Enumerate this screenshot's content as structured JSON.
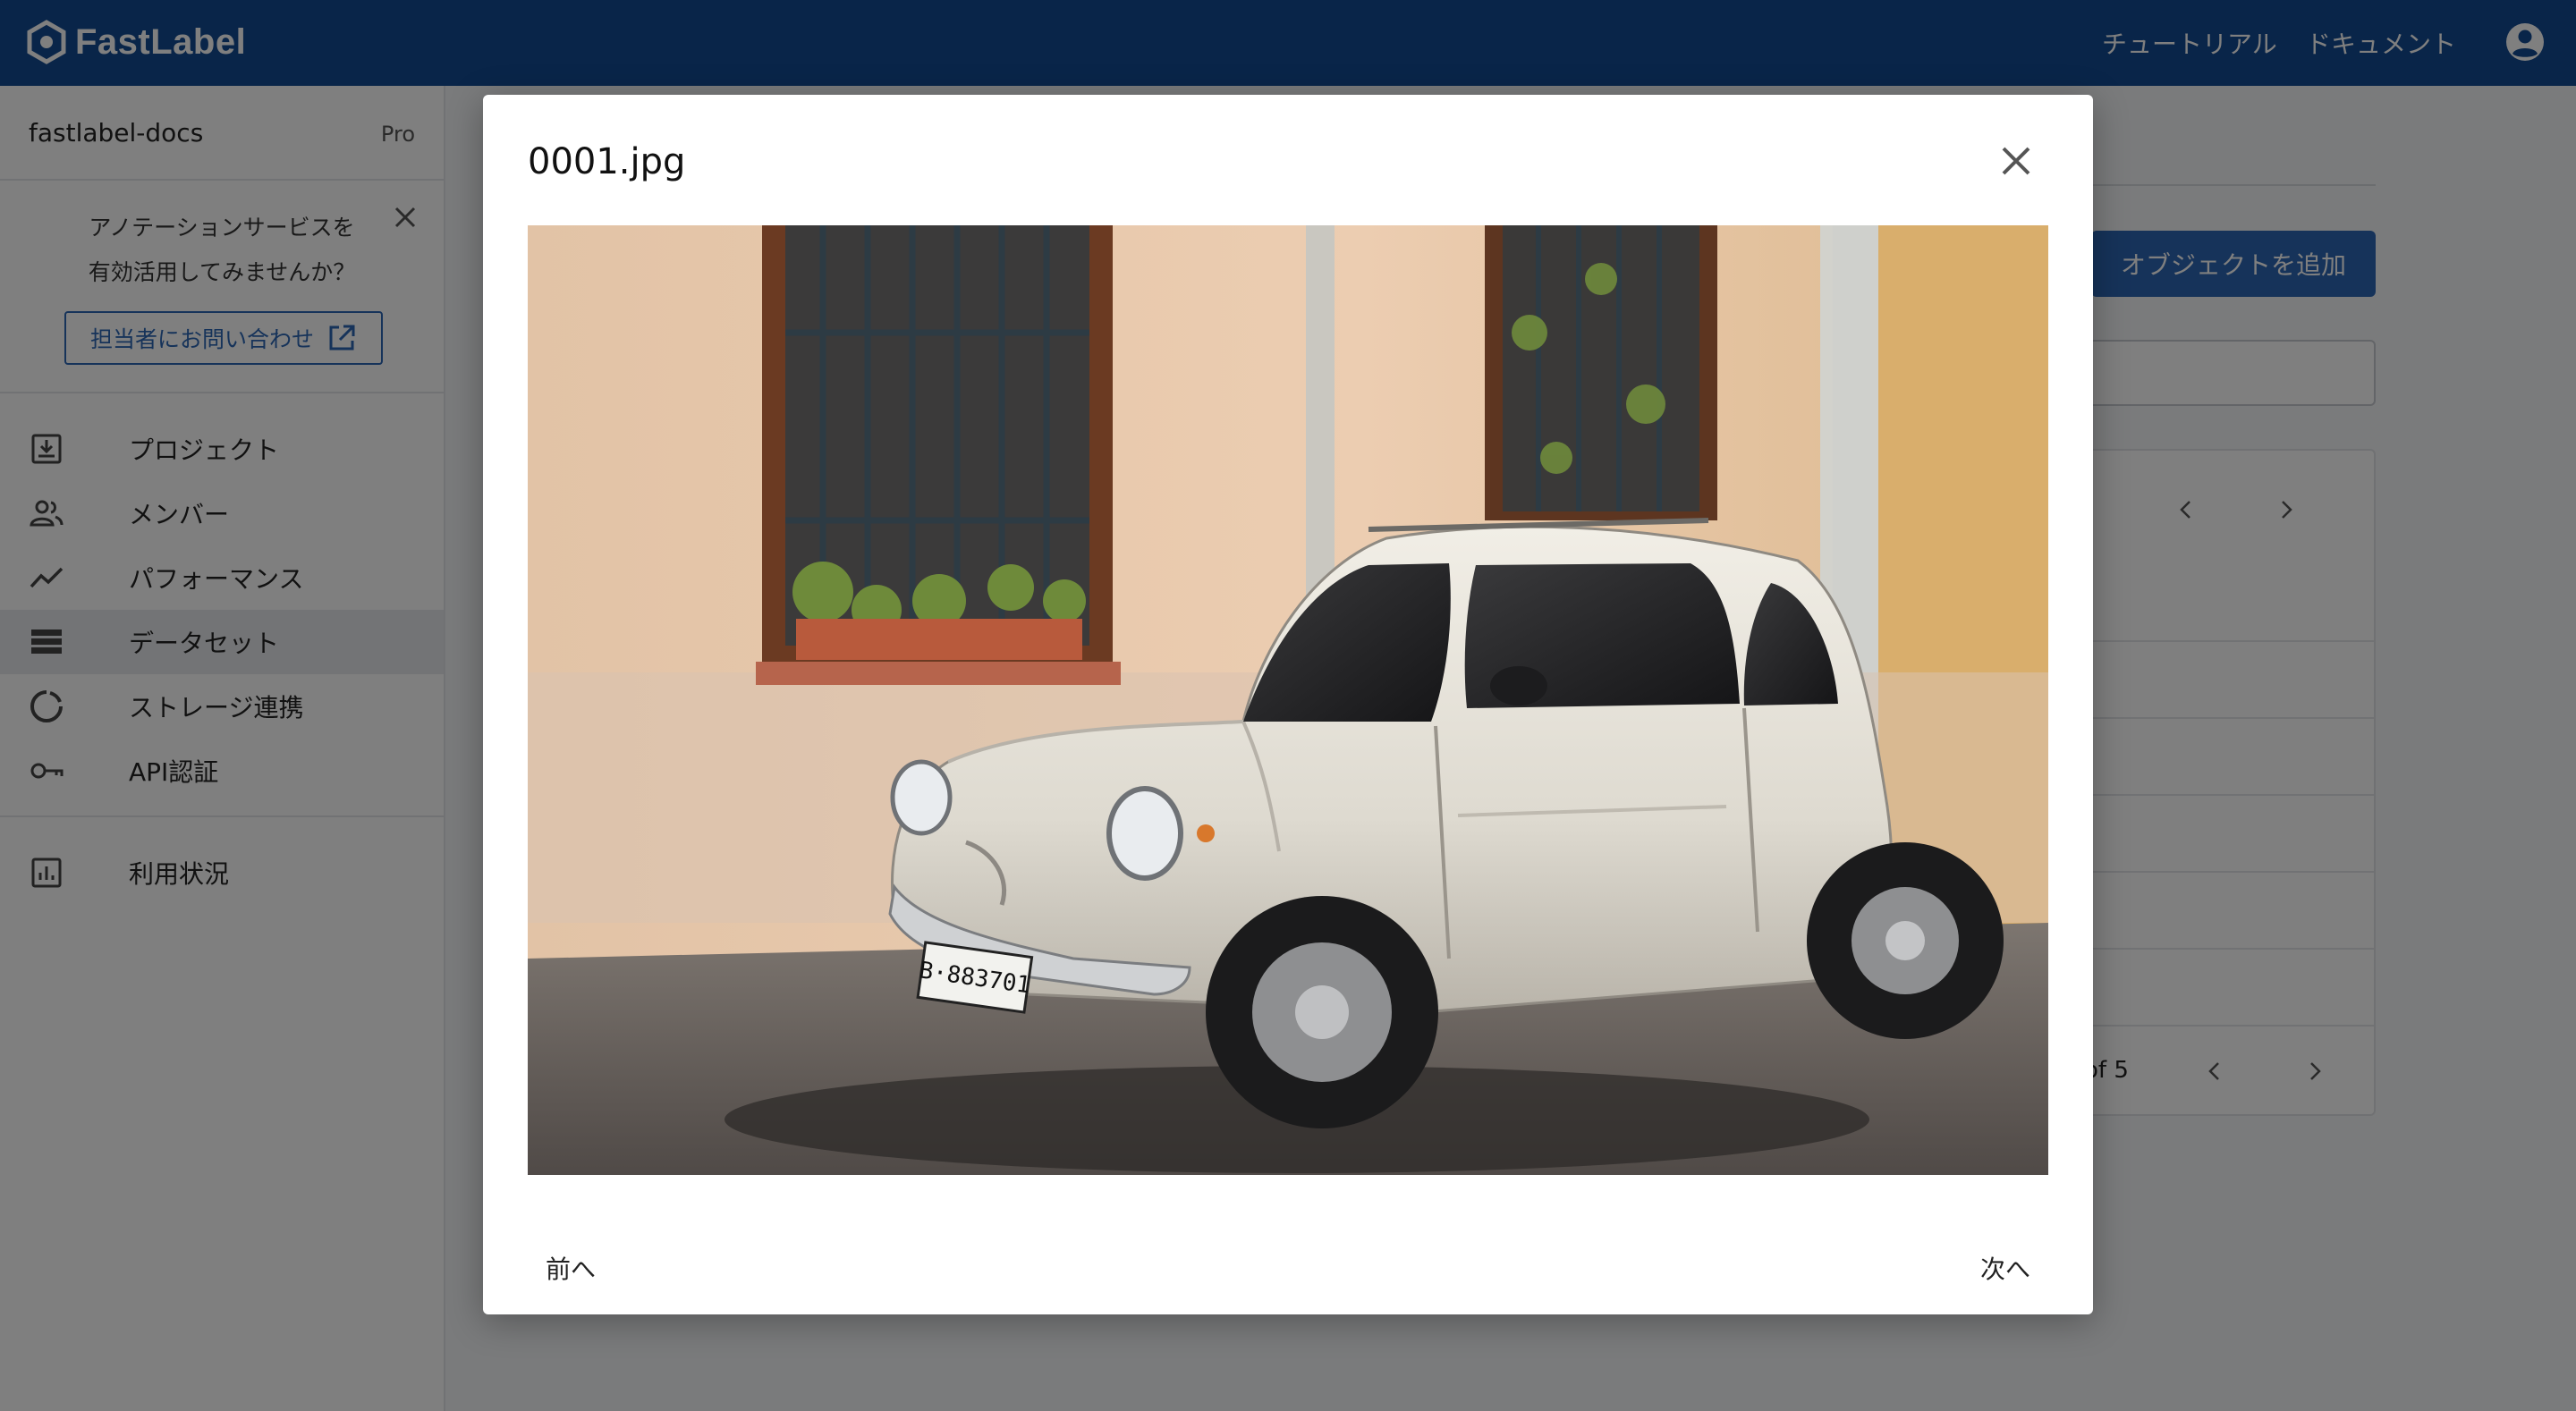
{
  "app": {
    "brand": "FastLabel",
    "brand_color": "#134b92",
    "accent_color": "#2c67b5"
  },
  "header": {
    "tutorial": "チュートリアル",
    "docs": "ドキュメント",
    "avatar_icon": "account-circle-icon"
  },
  "sidebar": {
    "org_name": "fastlabel-docs",
    "plan": "Pro",
    "promo": {
      "line1": "アノテーションサービスを",
      "line2": "有効活用してみませんか？",
      "button": "担当者にお問い合わせ"
    },
    "items": [
      {
        "label": "プロジェクト",
        "icon": "project-icon"
      },
      {
        "label": "メンバー",
        "icon": "members-icon"
      },
      {
        "label": "パフォーマンス",
        "icon": "trending-icon"
      },
      {
        "label": "データセット",
        "icon": "dataset-icon",
        "active": true
      },
      {
        "label": "ストレージ連携",
        "icon": "storage-sync-icon"
      },
      {
        "label": "API認証",
        "icon": "key-icon"
      }
    ],
    "usage": {
      "label": "利用状況",
      "icon": "usage-chart-icon"
    }
  },
  "main": {
    "add_object_button": "オブジェクトを追加",
    "pager_text": "of 5"
  },
  "modal": {
    "title": "0001.jpg",
    "prev": "前へ",
    "next": "次へ",
    "license_plate": "B·883701"
  }
}
